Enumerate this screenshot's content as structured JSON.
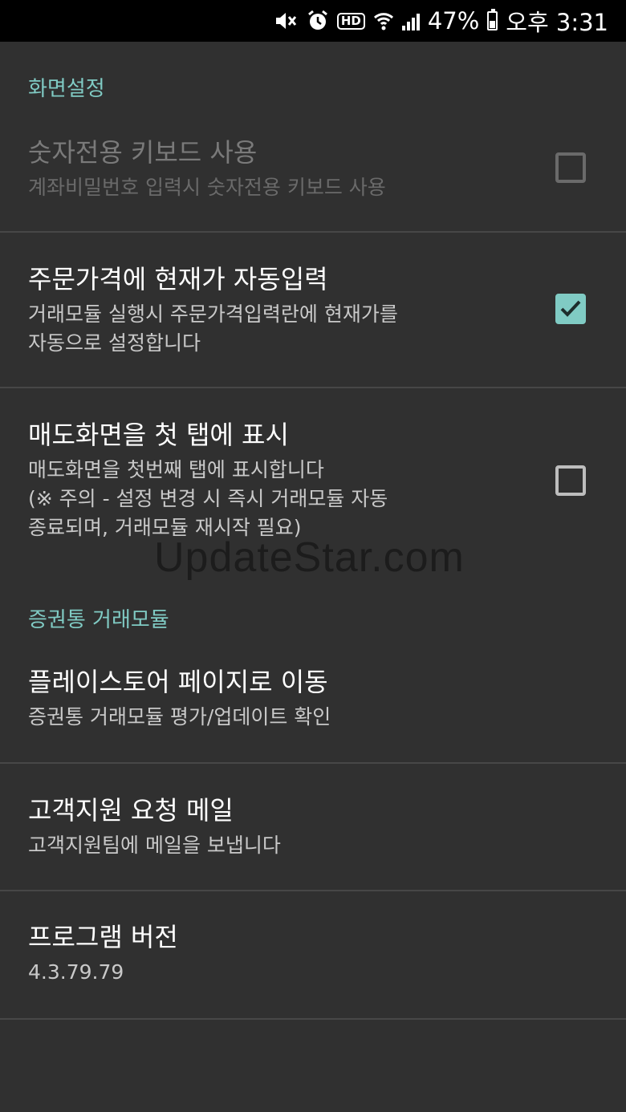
{
  "status_bar": {
    "battery_percent": "47%",
    "time": "오후 3:31",
    "icons": [
      "mute-icon",
      "alarm-icon",
      "hd-icon",
      "wifi-icon",
      "signal-icon",
      "battery-icon"
    ]
  },
  "sections": {
    "display": {
      "header": "화면설정",
      "items": [
        {
          "title": "숫자전용 키보드 사용",
          "summary": "계좌비밀번호 입력시 숫자전용 키보드 사용",
          "checked": false,
          "enabled": false
        },
        {
          "title": "주문가격에 현재가 자동입력",
          "summary": "거래모듈 실행시 주문가격입력란에 현재가를\n자동으로 설정합니다",
          "checked": true,
          "enabled": true
        },
        {
          "title": "매도화면을 첫 탭에 표시",
          "summary": "매도화면을 첫번째 탭에 표시합니다\n(※ 주의 - 설정 변경 시 즉시  거래모듈 자동\n종료되며, 거래모듈 재시작 필요)",
          "checked": false,
          "enabled": true
        }
      ]
    },
    "module": {
      "header": "증권통 거래모듈",
      "items": [
        {
          "title": "플레이스토어 페이지로 이동",
          "summary": "증권통 거래모듈 평가/업데이트 확인"
        },
        {
          "title": "고객지원 요청 메일",
          "summary": "고객지원팀에 메일을 보냅니다"
        },
        {
          "title": "프로그램 버전",
          "summary": "4.3.79.79"
        }
      ]
    }
  },
  "watermark": "UpdateStar.com",
  "colors": {
    "background": "#303030",
    "accent": "#80cbc4",
    "status_bar": "#000000",
    "divider": "#474747"
  }
}
